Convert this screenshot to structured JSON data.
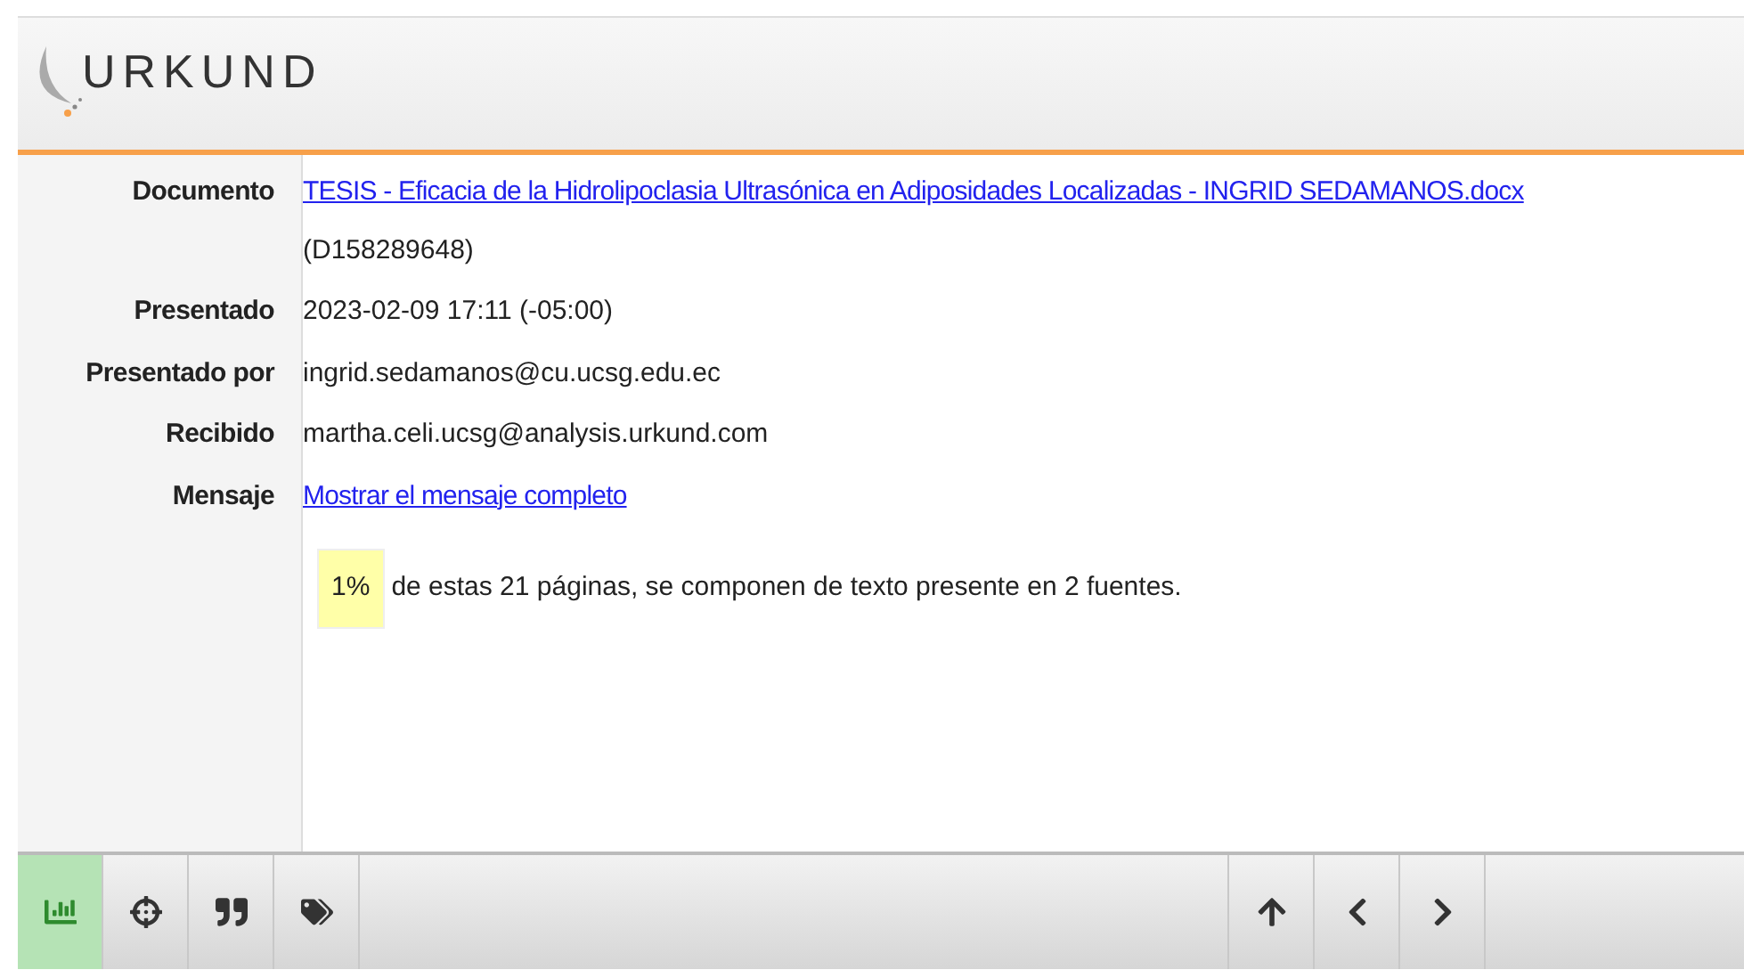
{
  "logo": {
    "text": "URKUND"
  },
  "details": [
    {
      "label": "Documento",
      "kind": "link",
      "value": "TESIS - Eficacia de la Hidrolipoclasia Ultrasónica en Adiposidades Localizadas - INGRID SEDAMANOS.docx",
      "note": "(D158289648)"
    },
    {
      "label": "Presentado",
      "kind": "text",
      "value": "2023-02-09 17:11 (-05:00)"
    },
    {
      "label": "Presentado por",
      "kind": "text",
      "value": "ingrid.sedamanos@cu.ucsg.edu.ec"
    },
    {
      "label": "Recibido",
      "kind": "text",
      "value": "martha.celi.ucsg@analysis.urkund.com"
    },
    {
      "label": "Mensaje",
      "kind": "link",
      "value": "Mostrar el mensaje completo"
    }
  ],
  "summary": {
    "percent": "1%",
    "text": "de estas 21 páginas, se componen de texto presente en 2 fuentes."
  },
  "toolbar": {
    "left": [
      {
        "kind": "chart",
        "selected": true
      },
      {
        "kind": "target",
        "selected": false
      },
      {
        "kind": "quote",
        "selected": false
      },
      {
        "kind": "tags",
        "selected": false
      }
    ],
    "right": [
      {
        "kind": "up"
      },
      {
        "kind": "prev"
      },
      {
        "kind": "next"
      }
    ]
  }
}
